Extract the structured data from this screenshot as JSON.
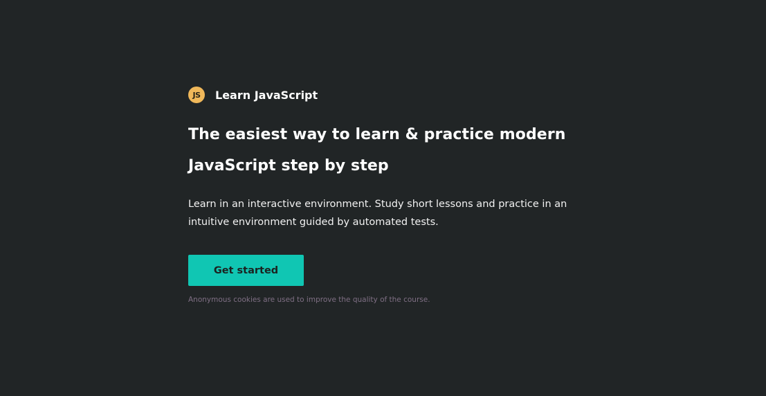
{
  "brand": {
    "logo_text": "JS",
    "name": "Learn JavaScript"
  },
  "hero": {
    "headline": "The easiest way to learn & practice modern JavaScript step by step",
    "description": "Learn in an interactive environment. Study short lessons and practice in an intuitive environment guided by automated tests."
  },
  "cta": {
    "label": "Get started"
  },
  "footer": {
    "cookie_note": "Anonymous cookies are used to improve the quality of the course."
  },
  "colors": {
    "background": "#212526",
    "logo": "#f0b85a",
    "accent": "#10c6b3",
    "note": "#7f6f84"
  }
}
